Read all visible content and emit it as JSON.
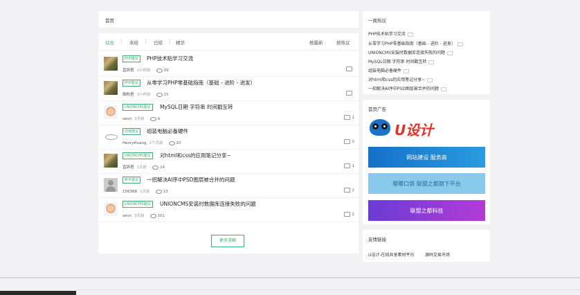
{
  "breadcrumb": {
    "label": "首页"
  },
  "tabs": [
    {
      "label": "综合",
      "active": true
    },
    {
      "label": "未结"
    },
    {
      "label": "已结"
    },
    {
      "label": "精华"
    }
  ],
  "sort": {
    "newest": "按最新",
    "hottest": "按热议"
  },
  "posts": [
    {
      "tag": "PHP建议",
      "title": "PHP技术贴学习交流",
      "author": "直辞君",
      "time": "2小时前",
      "views": "39",
      "comments": ""
    },
    {
      "tag": "PHP建议",
      "title": "从零学习PHP零基础指南（基础 - 进阶 - 进发）",
      "author": "鼓粉君",
      "time": "3小时前",
      "views": "15",
      "comments": ""
    },
    {
      "tag": "UNIONCMS建议",
      "title": "MySQL日期 字符串 时间戳互转",
      "author": "sevn",
      "time": "3天前",
      "views": "9",
      "comments": "1"
    },
    {
      "tag": "前端建议",
      "title": "组装电脑必备硬件",
      "author": "HenryHuang",
      "time": "2个月前",
      "views": "20",
      "comments": "0"
    },
    {
      "tag": "UNIONCMS建议",
      "title": "对html和css的应用笔记分享~",
      "author": "直辞君",
      "time": "1天前",
      "views": "24",
      "comments": "1"
    },
    {
      "tag": "新手建议",
      "title": "一招解决AI序中PSD图层被合并的问题",
      "author": "156368",
      "time": "1天前",
      "views": "13",
      "comments": "2"
    },
    {
      "tag": "UNIONCMS建议",
      "title": "UNIONCMS安装时数据库连接失败的问题",
      "author": "sevn",
      "time": "3天前",
      "views": "101",
      "comments": "2"
    }
  ],
  "more": {
    "label": "更多求解"
  },
  "hot": {
    "title": "一周热议",
    "items": [
      "PHP技术贴学习交流",
      "从零学习PHP零基础指南（基础 - 进阶 - 进发）",
      "UNIONCMS安装时数据库连接失败的问题",
      "MySQL日期 字符串 时间戳互转",
      "组装电脑必备硬件",
      "对html和css的应用笔记分享~",
      "一招解决AI序中PSD图层被合并的问题"
    ]
  },
  "ads": {
    "title": "首页广告",
    "logo_text": "U设计",
    "blue_text": "网站建设 服务商",
    "sky_text": "嘟嘟口袋 联盟之都旗下平台",
    "purple_text": "联盟之都科技"
  },
  "links": {
    "title": "友情链接",
    "items": [
      "U设计-在线共享素材平台",
      "源码交易市场"
    ]
  },
  "colors": {
    "accent": "#3cab6f",
    "background": "#f2f2f4"
  }
}
